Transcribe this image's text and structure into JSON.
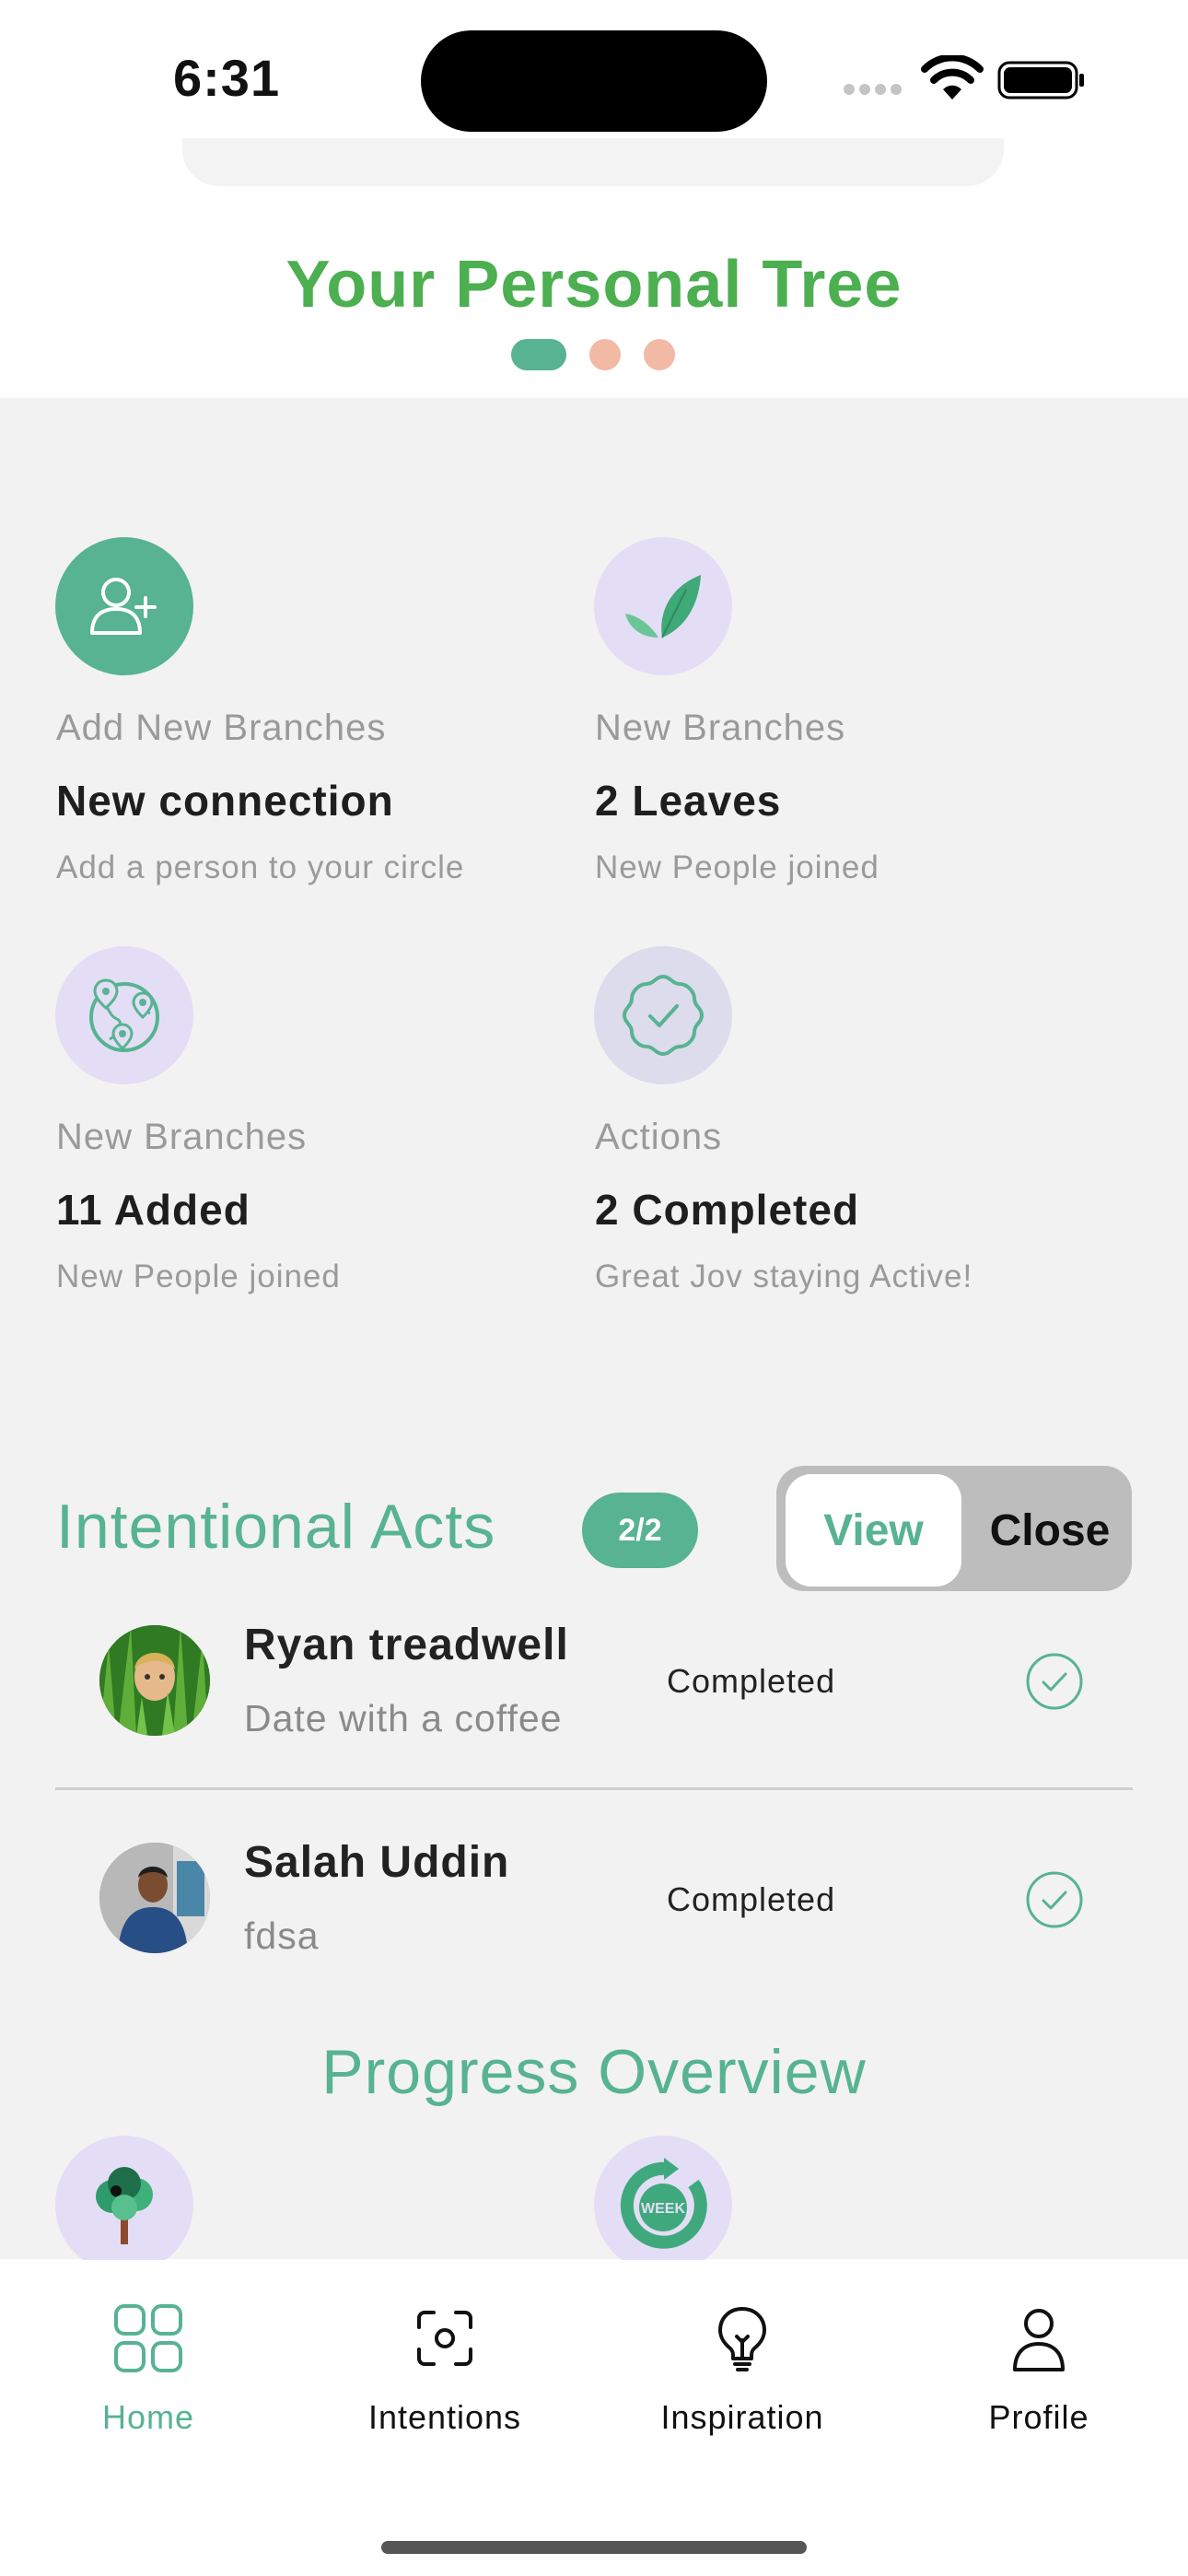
{
  "status_bar": {
    "time": "6:31"
  },
  "header": {
    "title": "Your Personal Tree"
  },
  "stats": [
    {
      "label": "Add New Branches",
      "value": "New connection",
      "sub": "Add a person to your circle",
      "icon": "add-user-icon"
    },
    {
      "label": "New Branches",
      "value": "2 Leaves",
      "sub": "New People joined",
      "icon": "leaf-icon"
    },
    {
      "label": "New Branches",
      "value": "11 Added",
      "sub": "New People joined",
      "icon": "globe-pins-icon"
    },
    {
      "label": "Actions",
      "value": "2 Completed",
      "sub": "Great Jov staying Active!",
      "icon": "badge-check-icon"
    }
  ],
  "intentional_acts": {
    "title": "Intentional Acts",
    "count": "2/2",
    "toggle": {
      "view_label": "View",
      "close_label": "Close"
    },
    "items": [
      {
        "name": "Ryan treadwell",
        "description": "Date with a coffee",
        "status": "Completed"
      },
      {
        "name": "Salah Uddin",
        "description": "fdsa",
        "status": "Completed"
      }
    ]
  },
  "progress": {
    "title": "Progress Overview",
    "week_badge": "WEEK"
  },
  "tabbar": {
    "items": [
      {
        "label": "Home",
        "icon": "grid-icon",
        "active": true
      },
      {
        "label": "Intentions",
        "icon": "scan-icon",
        "active": false
      },
      {
        "label": "Inspiration",
        "icon": "lightbulb-icon",
        "active": false
      },
      {
        "label": "Profile",
        "icon": "person-icon",
        "active": false
      }
    ]
  },
  "colors": {
    "accent": "#57b391",
    "title_green": "#4caf50",
    "dot_inactive": "#f2b9a4",
    "lavender": "#e3def5",
    "background": "#f2f2f2"
  }
}
